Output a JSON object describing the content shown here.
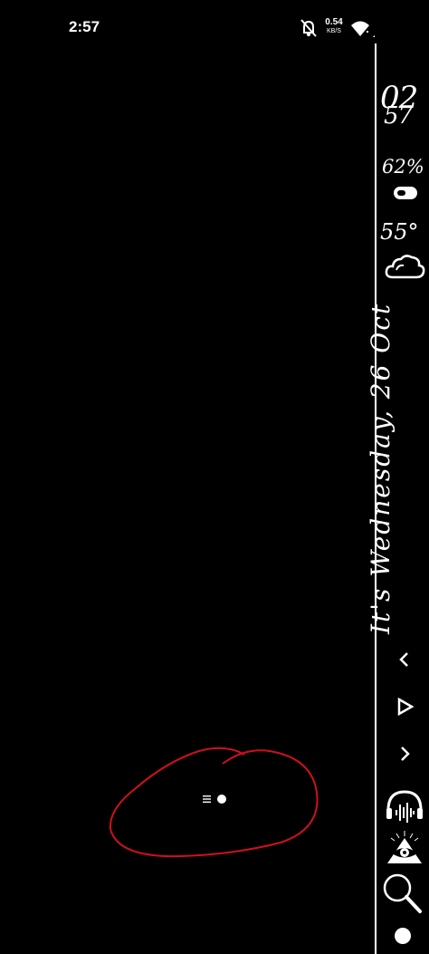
{
  "status_bar": {
    "time": "2:57",
    "net_speed_value": "0.54",
    "net_speed_unit": "KB/S",
    "icons": [
      "mute-bell-icon",
      "wifi-icon",
      "signal-icon"
    ]
  },
  "side_panel": {
    "clock_hour": "02",
    "clock_minute": "57",
    "battery_percent": "62%",
    "battery_level": 0.62,
    "temperature": "55°",
    "weather_icon": "cloud-icon",
    "date_text": "It's Wednesday, 26 Oct",
    "media_controls": [
      "previous-icon",
      "play-icon",
      "next-icon"
    ],
    "icons": [
      "music-headphones-icon",
      "eye-pyramid-icon",
      "search-icon",
      "home-dot-icon"
    ]
  },
  "colors": {
    "background": "#000000",
    "foreground": "#ffffff",
    "annotation": "#d0101e"
  }
}
